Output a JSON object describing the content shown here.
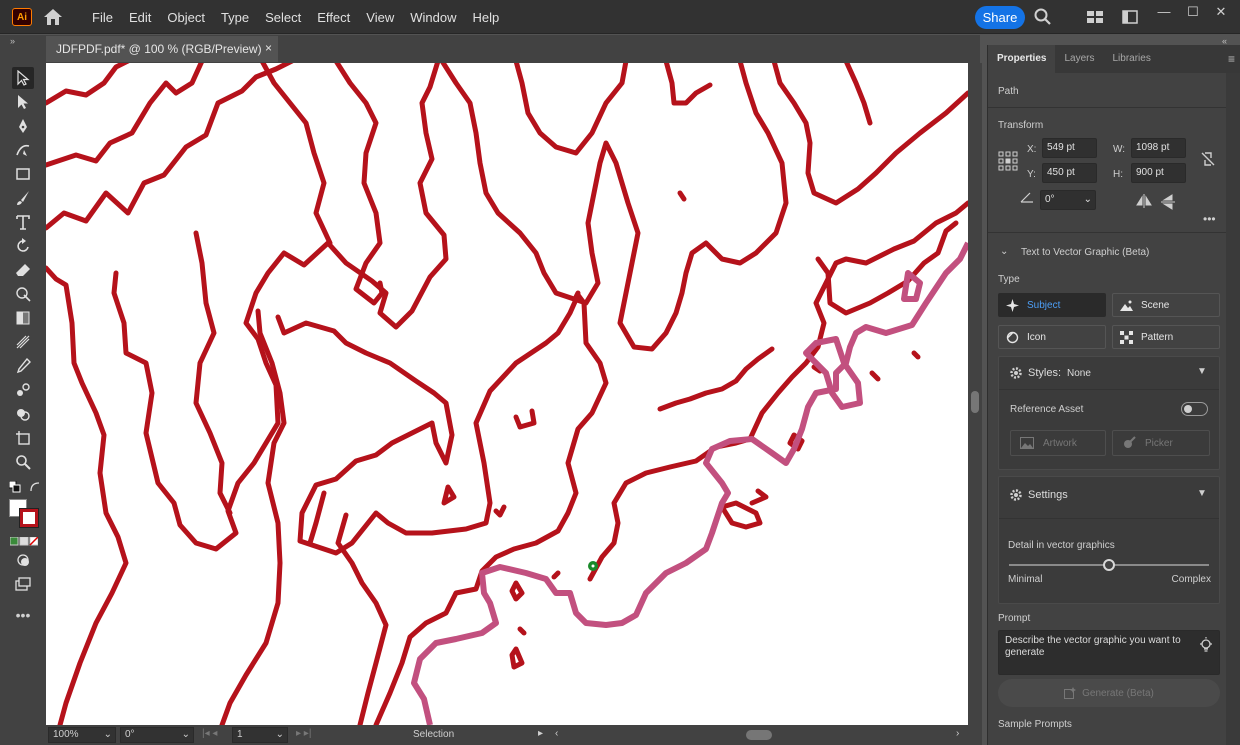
{
  "app": {
    "logo_text": "Ai"
  },
  "menu": [
    "File",
    "Edit",
    "Object",
    "Type",
    "Select",
    "Effect",
    "View",
    "Window",
    "Help"
  ],
  "share_label": "Share",
  "document_tab": {
    "title": "JDFPDF.pdf* @ 100 % (RGB/Preview)",
    "close": "×"
  },
  "panel": {
    "tabs": [
      "Properties",
      "Layers",
      "Libraries"
    ],
    "object_type": "Path",
    "transform": {
      "heading": "Transform",
      "x_label": "X:",
      "x": "549 pt",
      "y_label": "Y:",
      "y": "450 pt",
      "w_label": "W:",
      "w": "1098 pt",
      "h_label": "H:",
      "h": "900 pt",
      "angle": "0°"
    },
    "t2v_heading": "Text to Vector Graphic (Beta)",
    "type_heading": "Type",
    "types": {
      "subject": "Subject",
      "scene": "Scene",
      "icon": "Icon",
      "pattern": "Pattern"
    },
    "styles_label": "Styles:",
    "styles_value": "None",
    "reference_asset": "Reference Asset",
    "reference_asset_enabled": false,
    "artwork_btn": "Artwork",
    "picker_btn": "Picker",
    "settings_heading": "Settings",
    "detail_label": "Detail in vector graphics",
    "detail_min": "Minimal",
    "detail_max": "Complex",
    "detail_level": 0.5,
    "prompt_heading": "Prompt",
    "prompt_placeholder": "Describe the vector graphic you want to generate",
    "generate_btn": "Generate (Beta)",
    "sample_prompts": "Sample Prompts"
  },
  "status": {
    "zoom": "100%",
    "rotation": "0°",
    "artboard": "1",
    "tool": "Selection"
  },
  "colors": {
    "accent": "#1473e6",
    "contour": "#b5121b",
    "selected_path": "#c2507f",
    "anchor": "#1a8a2a"
  }
}
